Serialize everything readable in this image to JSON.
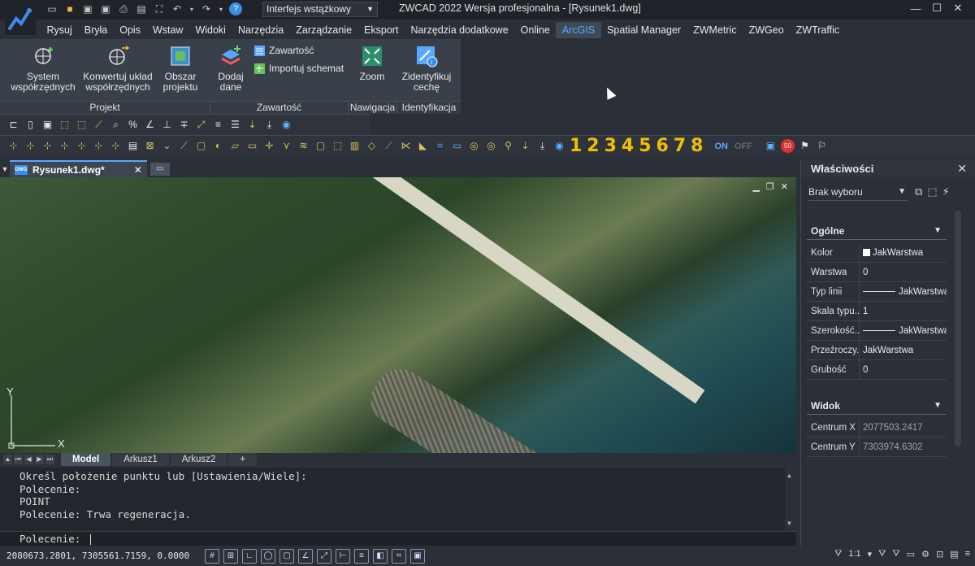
{
  "app": {
    "title": "ZWCAD 2022 Wersja profesjonalna - [Rysunek1.dwg]",
    "workspace": "Interfejs wstążkowy"
  },
  "menu": [
    "Rysuj",
    "Bryła",
    "Opis",
    "Wstaw",
    "Widoki",
    "Narzędzia",
    "Zarządzanie",
    "Eksport",
    "Narzędzia dodatkowe",
    "Online",
    "ArcGIS",
    "Spatial Manager",
    "ZWMetric",
    "ZWGeo",
    "ZWTraffic"
  ],
  "active_menu": "ArcGIS",
  "ribbon": {
    "system": "System\nwspółrzędnych",
    "konwertuj": "Konwertuj układ\nwspółrzędnych",
    "obszar": "Obszar\nprojektu",
    "dodaj": "Dodaj\ndane",
    "zawartosc_btn": "Zawartość",
    "importuj": "Importuj schemat",
    "zoom": "Zoom",
    "zidentyfikuj": "Zidentyfikuj\ncechę",
    "groups": {
      "projekt": "Projekt",
      "zawartosc": "Zawartość",
      "nawigacja": "Nawigacja",
      "identyfikacja": "Identyfikacja"
    }
  },
  "toolbar2": {
    "numbers": "12345678",
    "on": "ON",
    "off": "OFF"
  },
  "document_tab": "Rysunek1.dwg*",
  "axis": {
    "x": "X",
    "y": "Y"
  },
  "layout_tabs": [
    "Model",
    "Arkusz1",
    "Arkusz2",
    "+"
  ],
  "command_history": [
    "Określ położenie punktu lub [Ustawienia/Wiele]:",
    "Polecenie:",
    "POINT",
    "Polecenie: Trwa regeneracja."
  ],
  "command_prompt": "Polecenie:",
  "status": {
    "coords": "2080673.2801, 7305561.7159, 0.0000",
    "scale": "1:1"
  },
  "properties": {
    "title": "Właściwości",
    "selection": "Brak wyboru",
    "section_general": "Ogólne",
    "rows": [
      {
        "k": "Kolor",
        "v": "JakWarstwa"
      },
      {
        "k": "Warstwa",
        "v": "0"
      },
      {
        "k": "Typ linii",
        "v": "JakWarstwa"
      },
      {
        "k": "Skala typu...",
        "v": "1"
      },
      {
        "k": "Szerokość...",
        "v": "JakWarstwa"
      },
      {
        "k": "Przeźroczy...",
        "v": "JakWarstwa"
      },
      {
        "k": "Grubość",
        "v": "0"
      }
    ],
    "section_view": "Widok",
    "view_rows": [
      {
        "k": "Centrum X",
        "v": "2077503.2417"
      },
      {
        "k": "Centrum Y",
        "v": "7303974.6302"
      }
    ]
  }
}
